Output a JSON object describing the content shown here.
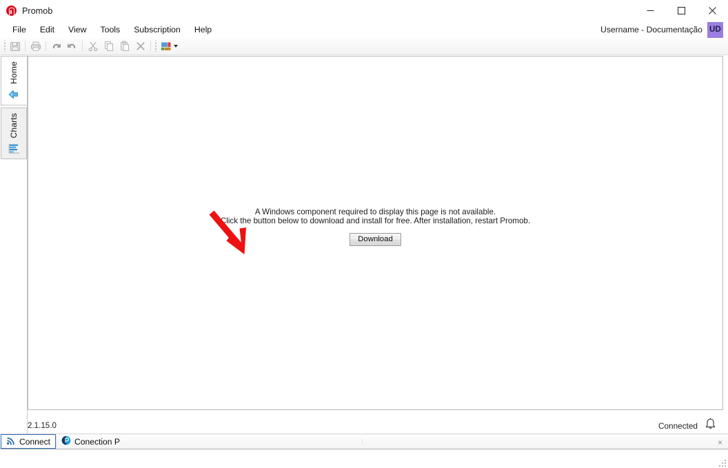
{
  "window": {
    "title": "Promob",
    "logo_icon": "promob-logo-icon",
    "minimize_icon": "minimize-icon",
    "maximize_icon": "maximize-icon",
    "close_icon": "close-icon"
  },
  "menubar": {
    "items": [
      {
        "label": "File"
      },
      {
        "label": "Edit"
      },
      {
        "label": "View"
      },
      {
        "label": "Tools"
      },
      {
        "label": "Subscription"
      },
      {
        "label": "Help"
      }
    ],
    "user": {
      "name": "Username - Documentação",
      "initials": "UD",
      "badge_color": "#9b7ee0"
    }
  },
  "toolbar": {
    "buttons": [
      {
        "name": "save-icon",
        "title": "Save",
        "enabled": false
      },
      {
        "name": "print-icon",
        "title": "Print",
        "enabled": false
      },
      {
        "name": "undo-icon",
        "title": "Undo",
        "enabled": true
      },
      {
        "name": "redo-icon",
        "title": "Redo",
        "enabled": true
      },
      {
        "name": "cut-icon",
        "title": "Cut",
        "enabled": false
      },
      {
        "name": "copy-icon",
        "title": "Copy",
        "enabled": false
      },
      {
        "name": "paste-icon",
        "title": "Paste",
        "enabled": false
      },
      {
        "name": "delete-icon",
        "title": "Delete",
        "enabled": false
      },
      {
        "name": "color-grid-icon",
        "title": "Colors",
        "enabled": true
      }
    ]
  },
  "sidebar": {
    "tabs": [
      {
        "label": "Home",
        "icon": "home-arrow-icon",
        "active": true
      },
      {
        "label": "Charts",
        "icon": "bar-chart-icon",
        "active": false
      }
    ]
  },
  "main": {
    "message_line1": "A Windows component required to display this page is not available.",
    "message_line2": "Click the button below to download and install for free. After installation, restart Promob.",
    "download_label": "Download",
    "annotation": {
      "name": "red-arrow-annotation",
      "color": "#ee1111"
    }
  },
  "statusbar": {
    "version": "2.1.15.0",
    "connection_status": "Connected",
    "bell_icon": "bell-icon"
  },
  "taskbar": {
    "items": [
      {
        "label": "Connect",
        "icon": "signal-icon",
        "selected": true
      },
      {
        "label": "Conection P",
        "icon": "promob-circle-icon",
        "selected": false
      }
    ],
    "close_label": "×"
  }
}
